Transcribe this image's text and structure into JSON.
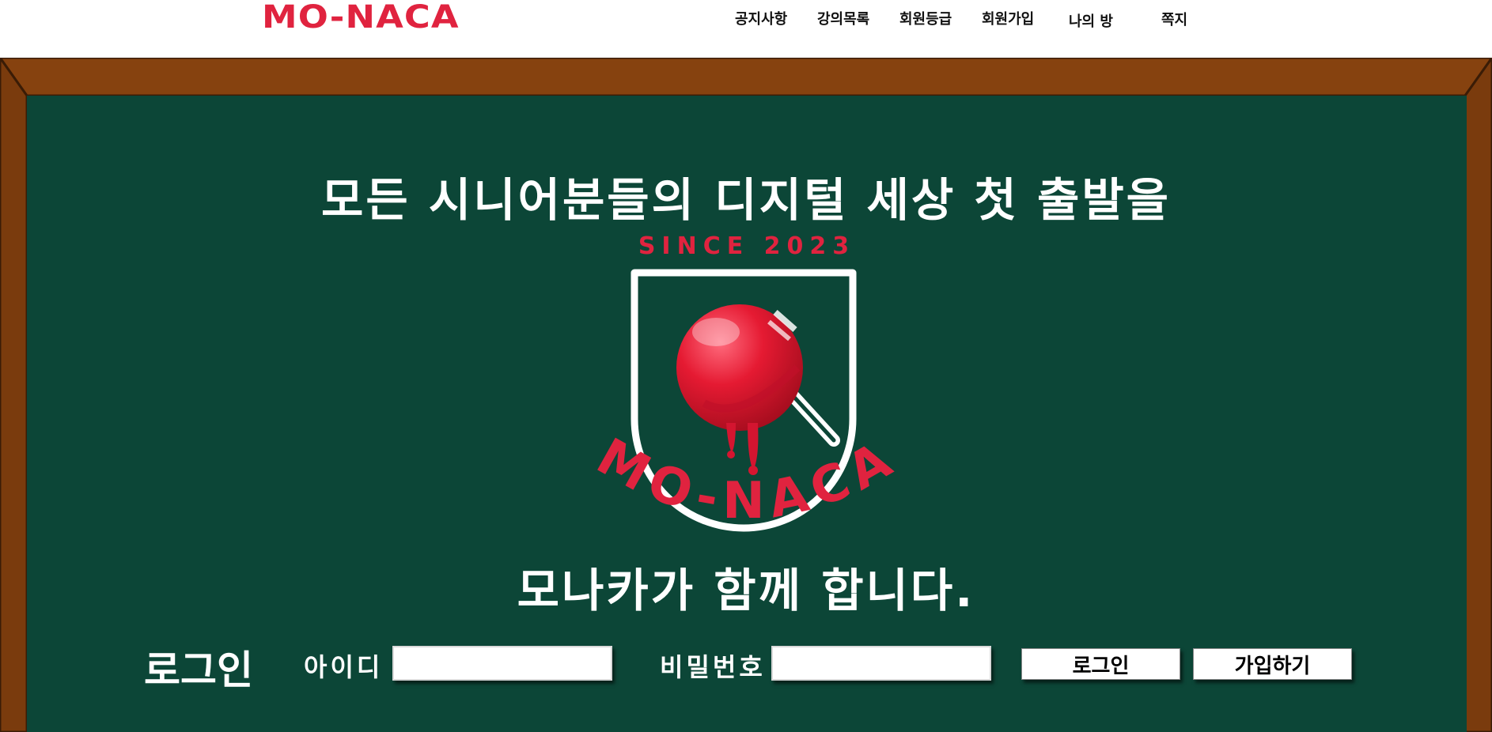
{
  "header": {
    "brand": "MO-NACA",
    "nav": [
      "공지사항",
      "강의목록",
      "회원등급",
      "회원가입",
      "나의 방",
      "쪽지"
    ]
  },
  "hero": {
    "line1": "모든 시니어분들의 디지털 세상 첫 출발을",
    "line2": "모나카가 함께 합니다.",
    "logo_since": "SINCE 2023",
    "logo_name": "MO-NACA"
  },
  "login": {
    "title": "로그인",
    "id_label": "아이디",
    "id_value": "",
    "password_label": "비밀번호",
    "password_value": "",
    "login_button": "로그인",
    "signup_button": "가입하기"
  },
  "colors": {
    "brand_red": "#e0233f",
    "board_green": "#0c4637",
    "frame_brown": "#86420f"
  }
}
